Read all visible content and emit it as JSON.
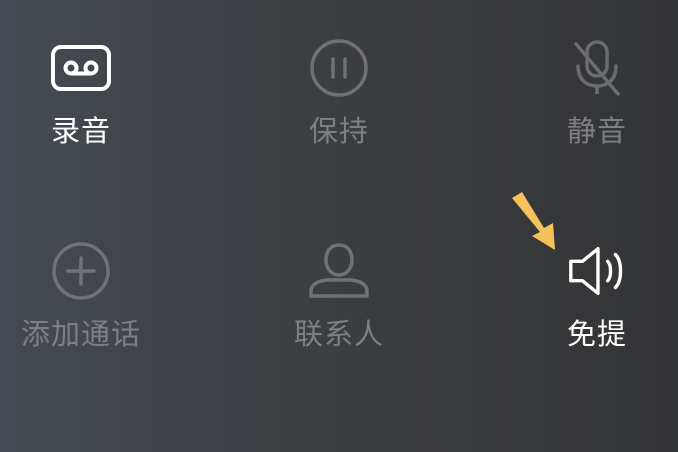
{
  "controls": {
    "record": {
      "label": "录音",
      "icon": "cassette-tape-icon",
      "state": "enabled"
    },
    "hold": {
      "label": "保持",
      "icon": "pause-circle-icon",
      "state": "disabled"
    },
    "mute": {
      "label": "静音",
      "icon": "microphone-off-icon",
      "state": "disabled"
    },
    "add_call": {
      "label": "添加通话",
      "icon": "plus-circle-icon",
      "state": "disabled"
    },
    "contacts": {
      "label": "联系人",
      "icon": "person-icon",
      "state": "disabled"
    },
    "speaker": {
      "label": "免提",
      "icon": "speaker-volume-icon",
      "state": "enabled"
    }
  },
  "annotation": {
    "icon": "arrow-down-right-icon",
    "color": "#f5c25a"
  },
  "colors": {
    "active": "#ffffff",
    "disabled": "#7d7f83"
  }
}
